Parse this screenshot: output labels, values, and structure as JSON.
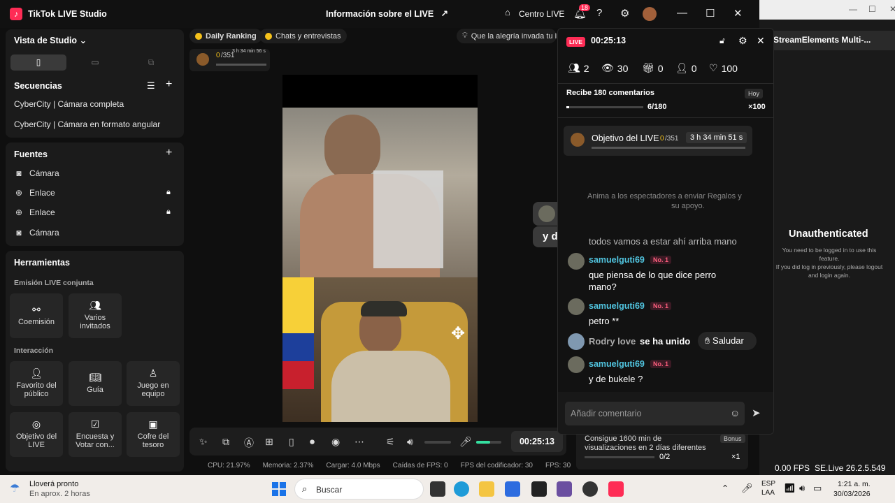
{
  "window": {
    "app_title": "TikTok LIVE Studio",
    "center_title": "Información sobre el LIVE",
    "centro_live": "Centro LIVE",
    "notif_count": "18"
  },
  "studio": {
    "title": "Vista de Studio"
  },
  "scenes": {
    "title": "Secuencias",
    "items": [
      "CyberCity | Cámara completa",
      "CyberCity | Cámara en formato angular"
    ]
  },
  "sources": {
    "title": "Fuentes",
    "items": [
      "Cámara",
      "Enlace",
      "Enlace",
      "Cámara"
    ]
  },
  "tools": {
    "title": "Herramientas",
    "section1": "Emisión LIVE conjunta",
    "t_coemision": "Coemisión",
    "t_varios": "Varios invitados",
    "section2": "Interacción",
    "t_favorito": "Favorito del público",
    "t_guia": "Guía",
    "t_juego": "Juego en equipo",
    "t_objetivo": "Objetivo del LIVE",
    "t_encuesta": "Encuesta y Votar con...",
    "t_cofre": "Cofre del tesoro"
  },
  "chips": {
    "daily": "Daily Ranking",
    "chats": "Chats y entrevistas",
    "msg": "Que la alegría invada tu L"
  },
  "goal_mini": {
    "value": "0",
    "total": "/351",
    "time": "3 h 34 min 56 s"
  },
  "overlay": {
    "user": "samuelguti69",
    "msg": "y de bukele ?"
  },
  "controls": {
    "timer": "00:25:13"
  },
  "stats": {
    "cpu": "CPU:  21.97%",
    "mem": "Memoria:  2.37%",
    "load": "Cargar:  4.0 Mbps",
    "fps_drop": "Caídas de FPS:  0",
    "enc": "FPS del codificador:  30",
    "fps": "FPS:  30"
  },
  "live": {
    "badge": "LIVE",
    "time": "00:25:13",
    "viewers": "2",
    "views": "30",
    "gifts": "0",
    "follows": "0",
    "likes": "100",
    "comments_title": "Recibe 180 comentarios",
    "comments_prog": "6/180",
    "hoy": "Hoy",
    "reward": "×100",
    "goal_title": "Objetivo del LIVE",
    "goal_val": "0",
    "goal_total": "/351",
    "goal_time": "3 h 34 min 51 s",
    "hint": "Anima a los espectadores a enviar Regalos y",
    "hint2": "su apoyo.",
    "partial": "todos vamos a estar ahí arriba mano",
    "messages": [
      {
        "user": "samuelguti69",
        "rank": "No. 1",
        "text": "que piensa de lo que dice perro mano?"
      },
      {
        "user": "samuelguti69",
        "rank": "No. 1",
        "text": "petro **"
      },
      {
        "user": "Rodry love",
        "joined": "se ha unido",
        "action": "Saludar"
      },
      {
        "user": "samuelguti69",
        "rank": "No. 1",
        "text": "y de bukele ?"
      }
    ],
    "input_placeholder": "Añadir comentario"
  },
  "bonus": {
    "text": "Consigue 1600 min de visualizaciones en 2 días diferentes",
    "tag": "Bonus",
    "prog": "0/2",
    "mult": "×1"
  },
  "rightwin": {
    "title": "StreamElements Multi-...",
    "heading": "Unauthenticated",
    "line1": "You need to be logged in to use this",
    "line2": "feature.",
    "line3": "If you did log in previously, please logout",
    "line4": "and login again.",
    "fps": "0.00 FPS",
    "ver": "SE.Live 26.2.5.549"
  },
  "taskbar": {
    "weather": "Lloverá pronto",
    "weather2": "En aprox. 2 horas",
    "search": "Buscar",
    "lang": "ESP",
    "lang2": "LAA",
    "time": "1:21 a. m.",
    "date": "30/03/2026"
  },
  "colors": {
    "accent": "#fe2c55",
    "name": "#51c5e0",
    "progress": "#35e0a0"
  }
}
